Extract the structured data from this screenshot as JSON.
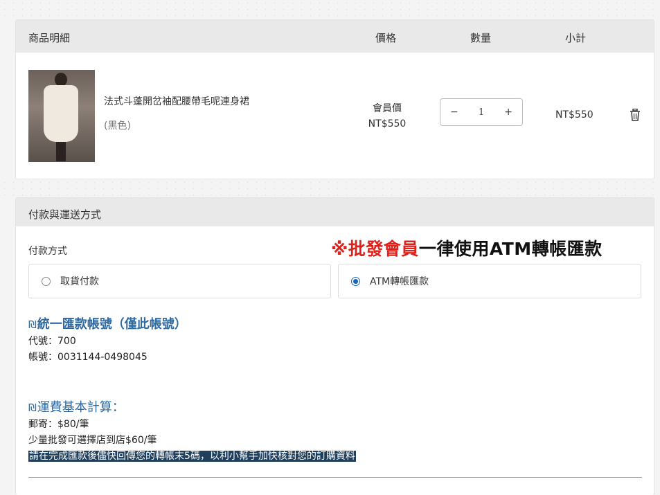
{
  "cart": {
    "headers": {
      "name": "商品明細",
      "price": "價格",
      "qty": "數量",
      "subtotal": "小計"
    },
    "item": {
      "name": "法式斗蓬開岔袖配腰帶毛呢連身裙",
      "variant": "(黑色)",
      "price_label": "會員價",
      "price": "NT$550",
      "qty": "1",
      "qty_minus": "−",
      "qty_plus": "+",
      "subtotal": "NT$550",
      "image_icon": "product-photo",
      "delete_icon": "trash-icon"
    }
  },
  "payment": {
    "header": "付款與運送方式",
    "method_label": "付款方式",
    "notice_red": "※批發會員",
    "notice_black": "一律使用ATM轉帳匯款",
    "options": [
      {
        "label": "取貨付款",
        "checked": false
      },
      {
        "label": "ATM轉帳匯款",
        "checked": true
      }
    ],
    "account_title": "統一匯款帳號（僅此帳號）",
    "account_code": "代號：700",
    "account_number": "帳號：0031144-0498045",
    "shipping_title": "運費基本計算：",
    "shipping_post": "郵寄：$80/筆",
    "shipping_store": "少量批發可選擇店到店$60/筆",
    "reminder": "請在完成匯款後儘快回傳您的轉帳末5碼，以利小幫手加快核對您的訂購資料",
    "title_glyph": "₪"
  },
  "colors": {
    "accent": "#2e6aa0",
    "notice_red": "#e0211b",
    "radio": "#1565c0",
    "highlight": "#1f3f5c"
  }
}
